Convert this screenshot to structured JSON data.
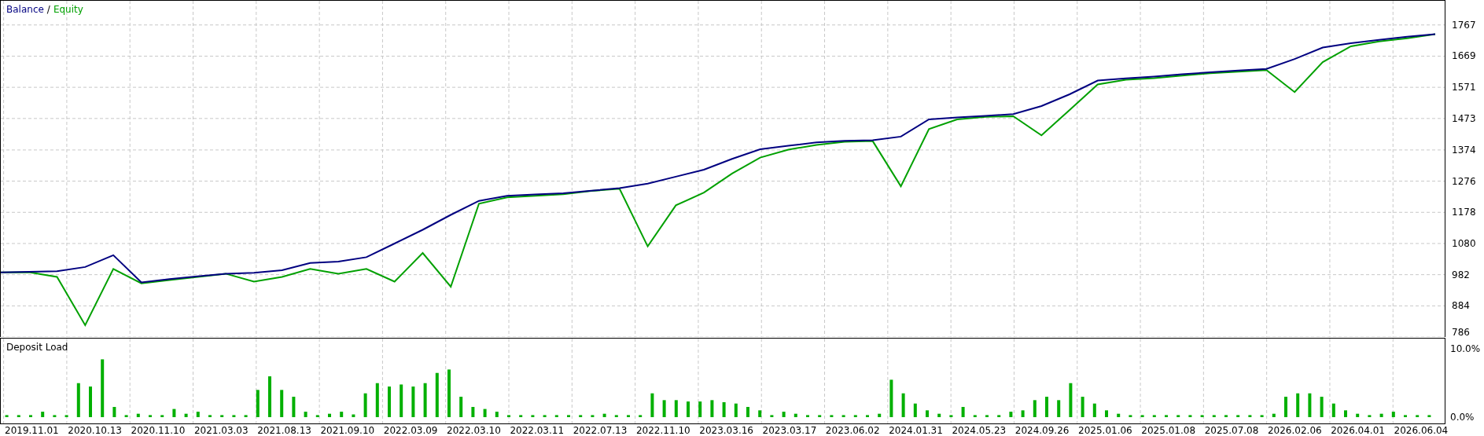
{
  "equity_chart": {
    "legend_separator": "/",
    "chart_data": {
      "type": "line",
      "grid": true,
      "ylim": [
        786,
        1843
      ],
      "categories": [
        null,
        null,
        null,
        null,
        null,
        null,
        null,
        null,
        null,
        null,
        null,
        null,
        null,
        null,
        null,
        null,
        null,
        null,
        null,
        null,
        null,
        null,
        null,
        null,
        null,
        null,
        null,
        null,
        null,
        null,
        null,
        null,
        null,
        null,
        null,
        null,
        null,
        null,
        null,
        null,
        null,
        null,
        null,
        null,
        null,
        null,
        null,
        null,
        null,
        null,
        null,
        null
      ],
      "series": [
        {
          "name": "Balance",
          "color": "#000080",
          "values": [
            989,
            991,
            993,
            1006,
            1043,
            958,
            968,
            977,
            985,
            988,
            996,
            1019,
            1023,
            1037,
            1080,
            1123,
            1170,
            1214,
            1230,
            1234,
            1238,
            1246,
            1254,
            1268,
            1290,
            1312,
            1346,
            1376,
            1387,
            1398,
            1403,
            1405,
            1416,
            1470,
            1476,
            1481,
            1487,
            1512,
            1549,
            1592,
            1599,
            1605,
            1612,
            1618,
            1624,
            1629,
            1660,
            1696,
            1710,
            1720,
            1730,
            1738
          ]
        },
        {
          "name": "Equity",
          "color": "#00a000",
          "values": [
            989,
            990,
            975,
            823,
            1000,
            955,
            965,
            975,
            985,
            960,
            975,
            1000,
            985,
            1000,
            960,
            1050,
            944,
            1205,
            1225,
            1230,
            1235,
            1245,
            1252,
            1071,
            1200,
            1240,
            1300,
            1350,
            1375,
            1390,
            1400,
            1402,
            1260,
            1440,
            1470,
            1478,
            1480,
            1420,
            1500,
            1580,
            1595,
            1600,
            1608,
            1615,
            1620,
            1625,
            1556,
            1650,
            1700,
            1715,
            1725,
            1738
          ]
        }
      ],
      "yticks": [
        {
          "value": 786,
          "label": "786"
        },
        {
          "value": 884,
          "label": "884"
        },
        {
          "value": 982,
          "label": "982"
        },
        {
          "value": 1080,
          "label": "1080"
        },
        {
          "value": 1178,
          "label": "1178"
        },
        {
          "value": 1276,
          "label": "1276"
        },
        {
          "value": 1374,
          "label": "1374"
        },
        {
          "value": 1473,
          "label": "1473"
        },
        {
          "value": 1571,
          "label": "1571"
        },
        {
          "value": 1669,
          "label": "1669"
        },
        {
          "value": 1767,
          "label": "1767"
        }
      ]
    }
  },
  "deposit_load": {
    "chart_data": {
      "type": "bar",
      "title": "Deposit Load",
      "grid": true,
      "ylim": [
        0,
        11.55
      ],
      "yticks": [
        {
          "value": 0,
          "label": "0.0%"
        },
        {
          "value": 10,
          "label": "10.0%"
        }
      ],
      "categories": [
        null,
        null,
        null,
        null,
        null,
        null,
        null,
        null,
        null,
        null,
        null,
        null,
        null,
        null,
        null,
        null,
        null,
        null,
        null,
        null,
        null,
        null,
        null,
        null,
        null,
        null,
        null,
        null,
        null,
        null,
        null,
        null,
        null,
        null,
        null,
        null,
        null,
        null,
        null,
        null,
        null,
        null,
        null,
        null,
        null,
        null,
        null,
        null,
        null,
        null,
        null,
        null,
        null,
        null,
        null,
        null,
        null,
        null,
        null,
        null,
        null,
        null,
        null,
        null,
        null,
        null,
        null,
        null,
        null,
        null,
        null,
        null,
        null,
        null,
        null,
        null,
        null,
        null,
        null,
        null,
        null,
        null,
        null,
        null,
        null,
        null,
        null,
        null,
        null,
        null,
        null,
        null,
        null,
        null,
        null,
        null,
        null,
        null,
        null,
        null,
        null,
        null,
        null,
        null,
        null,
        null,
        null,
        null,
        null,
        null,
        null,
        null,
        null,
        null,
        null,
        null,
        null,
        null,
        null,
        null
      ],
      "series": [
        {
          "color": "#00b000",
          "values": [
            0.3,
            0.3,
            0.3,
            0.8,
            0.3,
            0.3,
            5.0,
            4.5,
            8.5,
            1.5,
            0.3,
            0.5,
            0.3,
            0.3,
            1.2,
            0.5,
            0.8,
            0.3,
            0.3,
            0.3,
            0.3,
            4.0,
            6.0,
            4.0,
            3.0,
            0.8,
            0.3,
            0.5,
            0.8,
            0.4,
            3.5,
            5.0,
            4.5,
            4.8,
            4.5,
            5.0,
            6.5,
            7.0,
            3.0,
            1.5,
            1.2,
            0.8,
            0.3,
            0.3,
            0.3,
            0.3,
            0.3,
            0.3,
            0.3,
            0.3,
            0.5,
            0.3,
            0.3,
            0.3,
            3.5,
            2.5,
            2.5,
            2.3,
            2.3,
            2.5,
            2.2,
            2.0,
            1.5,
            1.0,
            0.3,
            0.8,
            0.5,
            0.3,
            0.3,
            0.3,
            0.3,
            0.3,
            0.3,
            0.5,
            5.5,
            3.5,
            2.0,
            1.0,
            0.5,
            0.3,
            1.5,
            0.3,
            0.3,
            0.3,
            0.8,
            1.0,
            2.5,
            3.0,
            2.5,
            5.0,
            3.0,
            2.0,
            1.0,
            0.5,
            0.3,
            0.3,
            0.3,
            0.3,
            0.3,
            0.3,
            0.3,
            0.3,
            0.3,
            0.3,
            0.3,
            0.3,
            0.5,
            3.0,
            3.5,
            3.5,
            3.0,
            2.0,
            1.0,
            0.5,
            0.3,
            0.5,
            0.8,
            0.3,
            0.3,
            0.3
          ]
        }
      ]
    }
  },
  "time_axis": {
    "labels": [
      "2019.11.01",
      "2020.10.13",
      "2020.11.10",
      "2021.03.03",
      "2021.08.13",
      "2021.09.10",
      "2022.03.09",
      "2022.03.10",
      "2022.03.11",
      "2022.07.13",
      "2022.11.10",
      "2023.03.16",
      "2023.03.17",
      "2023.06.02",
      "2024.01.31",
      "2024.05.23",
      "2024.09.26",
      "2025.01.06",
      "2025.01.08",
      "2025.07.08",
      "2026.02.06",
      "2026.04.01",
      "2026.06.04"
    ]
  }
}
